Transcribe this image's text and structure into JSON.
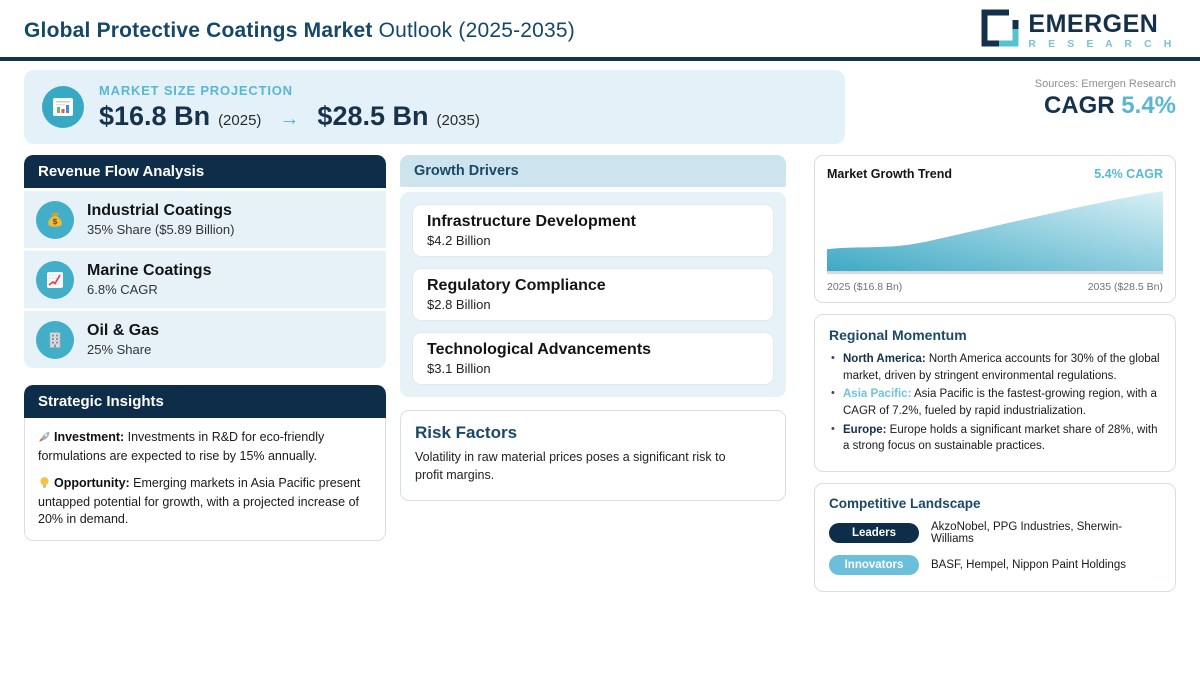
{
  "header": {
    "title_bold": "Global Protective Coatings Market",
    "title_regular": " Outlook (2025-2035)",
    "logo_name": "EMERGEN",
    "logo_sub": "R E S E A R C H"
  },
  "projection": {
    "label": "MARKET SIZE PROJECTION",
    "start_value": "$16.8 Bn",
    "start_year": "(2025)",
    "arrow": "→",
    "end_value": "$28.5 Bn",
    "end_year": "(2035)",
    "sources": "Sources: Emergen Research",
    "cagr_label": "CAGR ",
    "cagr_value": "5.4%"
  },
  "revenue_flow": {
    "title": "Revenue Flow Analysis",
    "items": [
      {
        "icon": "money-bag-icon",
        "title": "Industrial Coatings",
        "subtitle": "35% Share ($5.89 Billion)"
      },
      {
        "icon": "chart-up-icon",
        "title": "Marine Coatings",
        "subtitle": "6.8% CAGR"
      },
      {
        "icon": "building-icon",
        "title": "Oil & Gas",
        "subtitle": "25% Share"
      }
    ]
  },
  "strategic_insights": {
    "title": "Strategic Insights",
    "items": [
      {
        "icon": "rocket-icon",
        "label": "Investment:",
        "text": " Investments in R&D for eco-friendly formulations are expected to rise by 15% annually."
      },
      {
        "icon": "bulb-icon",
        "label": "Opportunity:",
        "text": " Emerging markets in Asia Pacific present untapped potential for growth, with a projected increase of 20% in demand."
      }
    ]
  },
  "growth_drivers": {
    "title": "Growth Drivers",
    "items": [
      {
        "title": "Infrastructure Development",
        "value": "$4.2 Billion"
      },
      {
        "title": "Regulatory Compliance",
        "value": "$2.8 Billion"
      },
      {
        "title": "Technological Advancements",
        "value": "$3.1 Billion"
      }
    ]
  },
  "risk_factors": {
    "title": "Risk Factors",
    "text": "Volatility in raw material prices poses a significant risk to profit margins."
  },
  "growth_trend": {
    "title": "Market Growth Trend",
    "cagr": "5.4% CAGR",
    "start_label": "2025 ($16.8 Bn)",
    "end_label": "2035 ($28.5 Bn)"
  },
  "chart_data": {
    "type": "area",
    "title": "Market Growth Trend",
    "x": [
      2025,
      2035
    ],
    "values": [
      16.8,
      28.5
    ],
    "unit": "USD Billion",
    "cagr_pct": 5.4,
    "xlabel": "",
    "ylabel": "",
    "tick_labels": [
      "2025 ($16.8 Bn)",
      "2035 ($28.5 Bn)"
    ],
    "grid": false,
    "legend_position": "none",
    "curve": "accelerating upward",
    "fill_gradient": [
      "#3fa9c4",
      "#d9f0f6"
    ]
  },
  "regional_momentum": {
    "title": "Regional Momentum",
    "items": [
      {
        "label": "North America:",
        "text": " North America accounts for 30% of the global market, driven by stringent environmental regulations.",
        "label_color": "#14304a"
      },
      {
        "label": "Asia Pacific:",
        "text": " Asia Pacific is the fastest-growing region, with a CAGR of 7.2%, fueled by rapid industrialization.",
        "label_color": "#6ec3dd"
      },
      {
        "label": "Europe:",
        "text": " Europe holds a significant market share of 28%, with a strong focus on sustainable practices.",
        "label_color": "#14304a"
      }
    ]
  },
  "competitive_landscape": {
    "title": "Competitive Landscape",
    "rows": [
      {
        "badge": "Leaders",
        "badge_color": "#0e2d49",
        "companies": "AkzoNobel, PPG Industries, Sherwin-Williams"
      },
      {
        "badge": "Innovators",
        "badge_color": "#6bbfda",
        "companies": "BASF, Hempel, Nippon Paint Holdings"
      }
    ]
  },
  "colors": {
    "navy": "#0e2d49",
    "navy_text": "#15476b",
    "teal_accent": "#56b8d4",
    "teal_circle": "#3fa9c4",
    "light_blue_bg": "#e4f1f8",
    "panel_row_bg": "#e6f2f8",
    "growth_header_bg": "#cde4ef",
    "divider": "#14344e"
  }
}
